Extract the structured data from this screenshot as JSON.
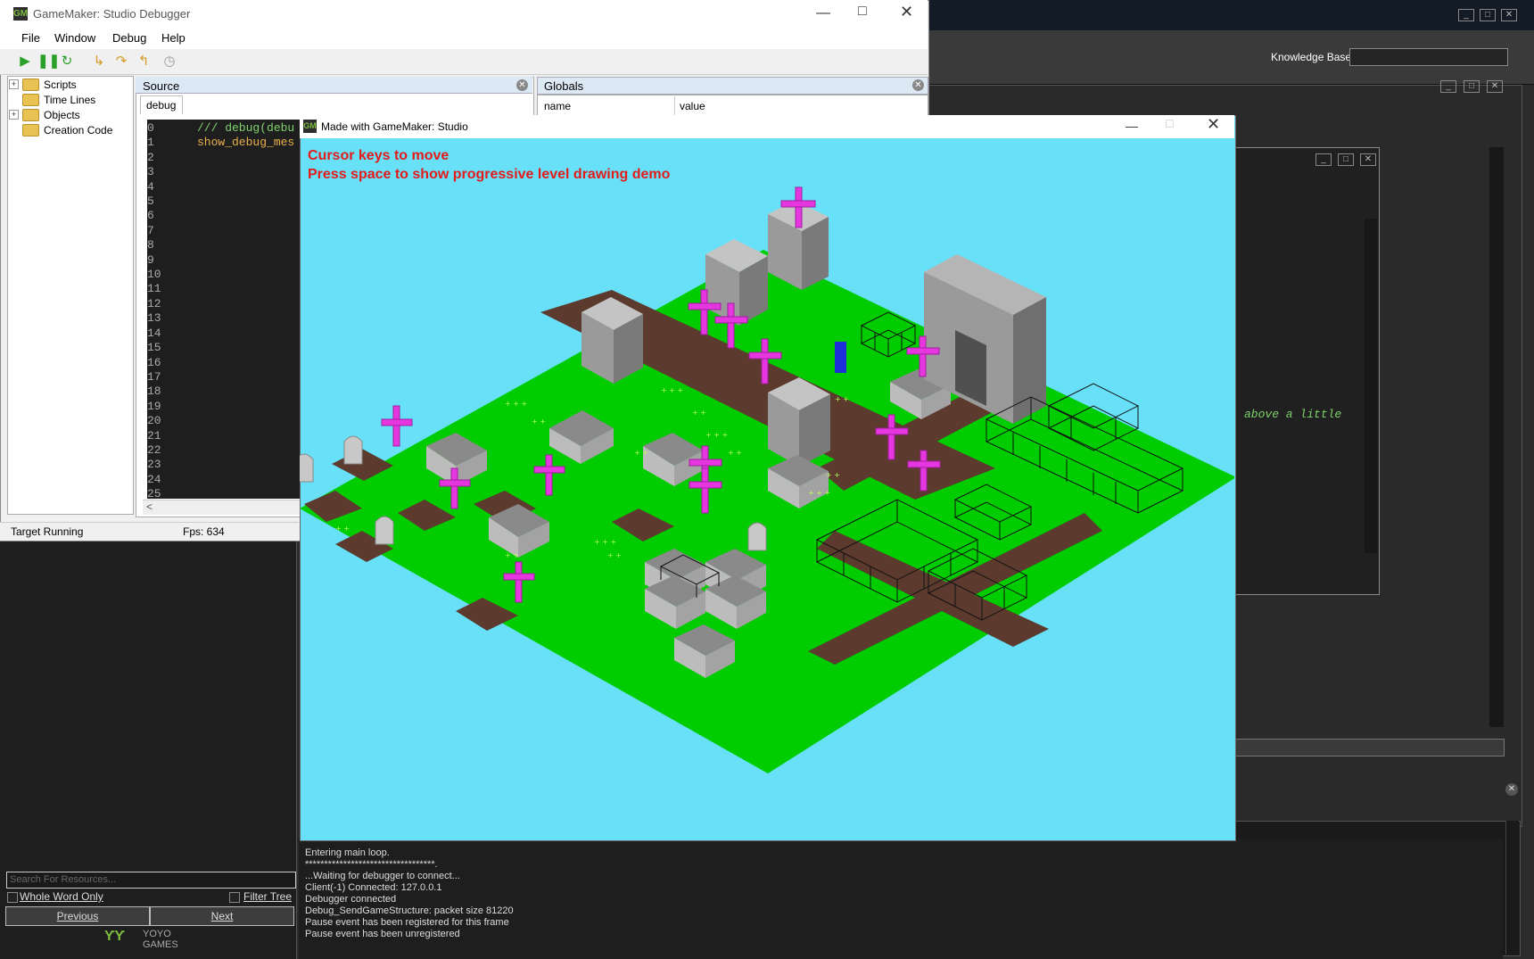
{
  "background_ide": {
    "knowledge_base_label": "Knowledge Base:",
    "code_snippet": "above a little"
  },
  "debugger": {
    "title": "GameMaker: Studio Debugger",
    "menu": [
      "File",
      "Window",
      "Debug",
      "Help"
    ],
    "resource_tree": [
      {
        "label": "Scripts",
        "expandable": true
      },
      {
        "label": "Time Lines",
        "expandable": false
      },
      {
        "label": "Objects",
        "expandable": true
      },
      {
        "label": "Creation Code",
        "expandable": false
      }
    ],
    "source": {
      "header": "Source",
      "tab": "debug",
      "line_numbers": [
        "0",
        "1",
        "2",
        "3",
        "4",
        "5",
        "6",
        "7",
        "8",
        "9",
        "10",
        "11",
        "12",
        "13",
        "14",
        "15",
        "16",
        "17",
        "18",
        "19",
        "20",
        "21",
        "22",
        "23",
        "24",
        "25"
      ],
      "line0": "/// debug(debu",
      "line1": "show_debug_mes"
    },
    "globals": {
      "header": "Globals",
      "col_name": "name",
      "col_value": "value"
    },
    "status": "Target Running",
    "fps": "Fps: 634"
  },
  "resource_search": {
    "placeholder": "Search For Resources...",
    "whole_word": "Whole Word Only",
    "filter_tree": "Filter Tree",
    "previous": "Previous",
    "next": "Next"
  },
  "logo": {
    "brand_top": "YOYO",
    "brand_bottom": "GAMES"
  },
  "game": {
    "title": "Made with GameMaker: Studio",
    "hint1": "Cursor keys to move",
    "hint2": "Press space to show progressive level drawing demo",
    "colors": {
      "sky": "#68e1f8",
      "grass": "#00cc00",
      "path": "#5c3a2e",
      "cross": "#e536e0",
      "stone": "#8a8a8a",
      "player": "#1f2fd8"
    }
  },
  "output_log": [
    "Entering main loop.",
    "**********************************.",
    "...Waiting for debugger to connect...",
    "Client(-1) Connected: 127.0.0.1",
    "Debugger connected",
    "Debug_SendGameStructure: packet size 81220",
    "Pause event has been registered for this frame",
    "Pause event has been unregistered"
  ]
}
